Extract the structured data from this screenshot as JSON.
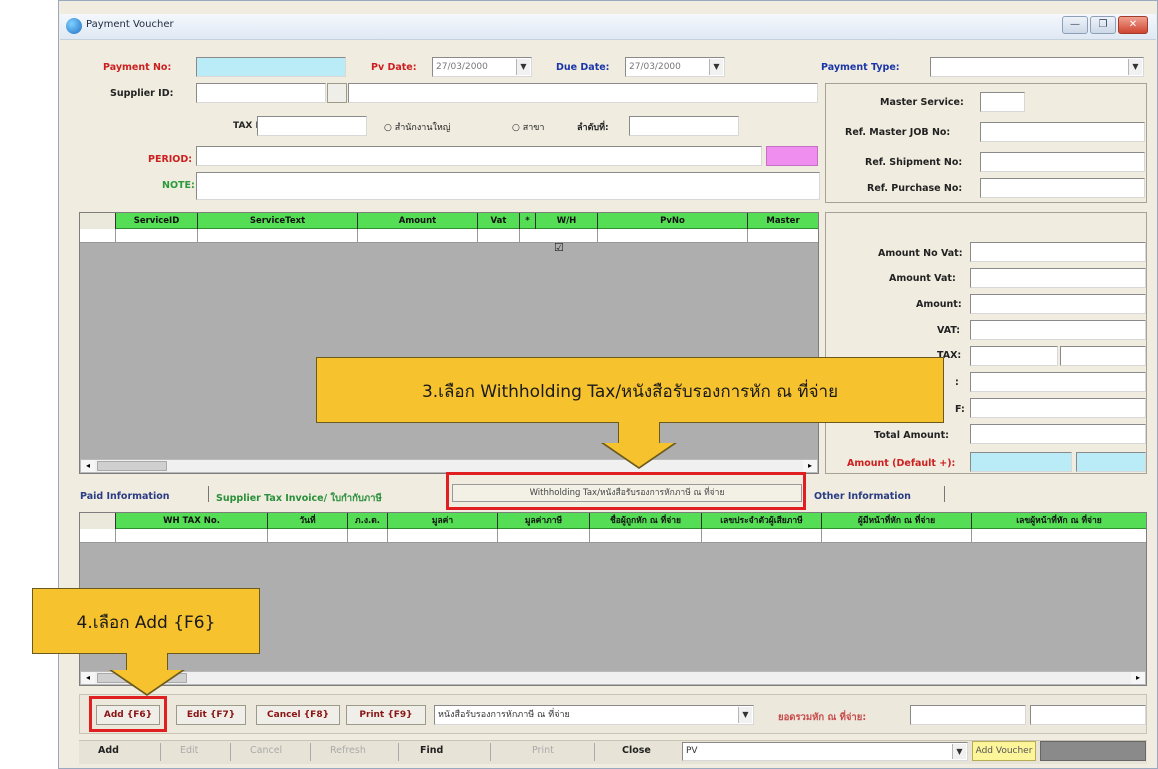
{
  "window": {
    "title": "Payment Voucher",
    "controls": [
      "—",
      "❐",
      "✕"
    ]
  },
  "header": {
    "payment_no_label": "Payment No:",
    "pv_date_label": "Pv Date:",
    "pv_date_value": "27/03/2000",
    "due_date_label": "Due Date:",
    "due_date_value": "27/03/2000",
    "payment_type_label": "Payment Type:",
    "supplier_id_label": "Supplier ID:",
    "tax_id_label": "TAX ID:",
    "radio_head_office": "สำนักงานใหญ่",
    "radio_branch": "สาขา",
    "branch_no_label": "ลำดับที่:",
    "period_label": "PERIOD:",
    "note_label": "NOTE:"
  },
  "right_panel": {
    "master_service_label": "Master Service:",
    "ref_master_job_label": "Ref. Master JOB No:",
    "ref_shipment_label": "Ref. Shipment No:",
    "ref_purchase_label": "Ref. Purchase No:"
  },
  "service_grid": {
    "columns": [
      "ServiceID",
      "ServiceText",
      "Amount",
      "Vat",
      "*",
      "W/H",
      "PvNo",
      "Master"
    ],
    "checkbox_mark": "☑"
  },
  "totals": {
    "amount_no_vat_label": "Amount No Vat:",
    "amount_vat_label": "Amount Vat:",
    "amount_label": "Amount:",
    "vat_label": "VAT:",
    "tax_label": "TAX:",
    "partial_1": ":",
    "partial_2": "F:",
    "total_amount_label": "Total Amount:",
    "amount_default_label": "Amount (Default +):"
  },
  "tabs": {
    "paid_info": "Paid Information",
    "supplier_tax_invoice": "Supplier Tax Invoice/ ใบกำกับภาษี",
    "withholding": "Withholding Tax/หนังสือรับรองการหักภาษี ณ ที่จ่าย",
    "other_info": "Other Information"
  },
  "wh_grid": {
    "columns": [
      "WH TAX No.",
      "วันที่",
      "ภ.ง.ด.",
      "มูลค่า",
      "มูลค่าภาษี",
      "ชื่อผู้ถูกหัก ณ ที่จ่าย",
      "เลขประจำตัวผู้เสียภาษี",
      "ผู้มีหน้าที่หัก ณ ที่จ่าย",
      "เลขผู้หน้าที่หัก ณ ที่จ่าย"
    ]
  },
  "wh_toolbar": {
    "add": "Add {F6}",
    "edit": "Edit {F7}",
    "cancel": "Cancel {F8}",
    "print": "Print {F9}",
    "doc_select": "หนังสือรับรองการหักภาษี ณ ที่จ่าย",
    "right_label": "ยอดรวมหัก ณ ที่จ่าย:"
  },
  "bottom_toolbar": {
    "add": "Add",
    "edit": "Edit",
    "cancel": "Cancel",
    "refresh": "Refresh",
    "find": "Find",
    "print": "Print",
    "close": "Close",
    "pv_select": "PV",
    "add_voucher": "Add Voucher"
  },
  "callouts": {
    "step3": "3.เลือก Withholding Tax/หนังสือรับรองการหัก ณ ที่จ่าย",
    "step4": "4.เลือก Add {F6}"
  },
  "colors": {
    "callout": "#f6c22e",
    "highlight": "#e02020",
    "grid_header": "#55dd55",
    "cyan_field": "#b9ecf6",
    "pink_field": "#f08ef0"
  }
}
